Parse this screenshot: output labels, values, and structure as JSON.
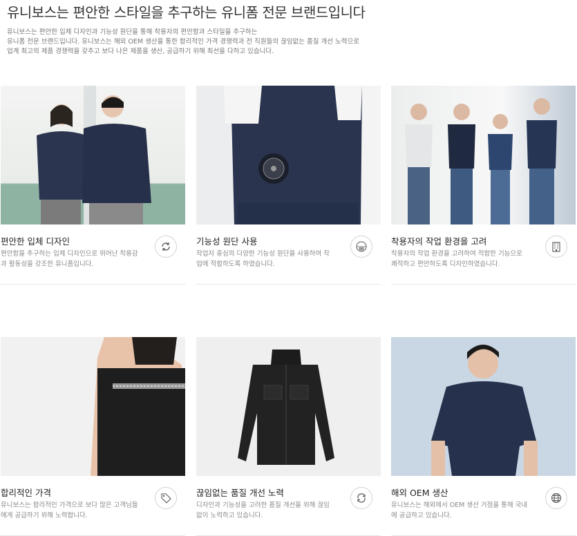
{
  "header": {
    "title": "유니보스는 편안한 스타일을 추구하는 유니폼 전문 브랜드입니다",
    "desc_lines": [
      "유니보스는 편안한 입체 디자인과 기능성 원단을 통해 착용자의 편안함과 스타일을 추구하는",
      "유니폼 전문 브랜드입니다. 유니보스는 해외 OEM 생산을 통한 합리적인 가격 경쟁력과 전 직원들의 끊임없는 품질 개선 노력으로",
      "업계 최고의 제품 경쟁력을 갖추고 보다 나은 제품을 생산, 공급하기 위해 최선을 다하고 있습니다."
    ]
  },
  "cards": [
    {
      "title": "편안한 입체 디자인",
      "text": "편안함을 추구하는 입체 디자인으로 뛰어난 착용감과 활동성을 강조한 유니폼입니다.",
      "icon": "refresh-arrows-icon",
      "photo": "couple-in-navy-jackets"
    },
    {
      "title": "기능성 원단 사용",
      "text": "작업자 중심의 다양한 기능성 원단을 사용하여 작업에 적합하도록 하였습니다.",
      "icon": "fabric-mesh-icon",
      "photo": "cooling-fan-vest"
    },
    {
      "title": "착용자의 작업 환경을 고려",
      "text": "착용자의 작업 환경을 고려하여 적합한 기능으로 쾌적하고 편안하도록 디자인하였습니다.",
      "icon": "building-icon",
      "photo": "group-in-polo-shirts"
    },
    {
      "title": "합리적인 가격",
      "text": "유니보스는 합리적인 가격으로 보다 많은 고객님들에게 공급하기 위해 노력합니다.",
      "icon": "price-tag-icon",
      "photo": "reflective-stripe-jacket"
    },
    {
      "title": "끊임없는 품질 개선 노력",
      "text": "디자인과 기능성을 고려한 품질 개선을 위해 끊임없이 노력하고 있습니다.",
      "icon": "sync-icon",
      "photo": "black-work-jacket"
    },
    {
      "title": "해외 OEM 생산",
      "text": "유니보스는 해외에서 OEM 생산 거점을 통해 국내에 공급하고 있습니다.",
      "icon": "globe-icon",
      "photo": "man-in-navy-polo"
    }
  ],
  "colors": {
    "navy": "#2a344f",
    "dark": "#1f1f1f",
    "bg_light": "#eef0f2"
  }
}
